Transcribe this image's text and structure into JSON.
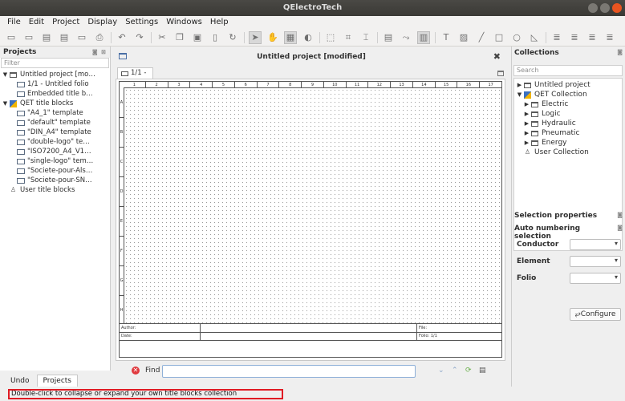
{
  "window": {
    "title": "QElectroTech"
  },
  "menu": [
    "File",
    "Edit",
    "Project",
    "Display",
    "Settings",
    "Windows",
    "Help"
  ],
  "toolbar": {
    "icons": [
      "new-project-icon",
      "open-icon",
      "save-icon",
      "save-as-icon",
      "close-project-icon",
      "print-icon",
      "undo-icon",
      "redo-icon",
      "cut-icon",
      "copy-icon",
      "paste-icon",
      "delete-icon",
      "rotate-icon",
      "select-icon",
      "hand-icon",
      "grid-icon",
      "mode-icon",
      "zoom-fit-icon",
      "zoom-content-icon",
      "zoom-reset-icon",
      "add-folio-icon",
      "conductor-icon",
      "titleblock-icon",
      "text-icon",
      "image-icon",
      "line-icon",
      "rectangle-icon",
      "ellipse-icon",
      "polygon-icon",
      "align-icon",
      "align-2-icon",
      "align-3-icon",
      "align-4-icon"
    ]
  },
  "projects": {
    "title": "Projects",
    "filter_placeholder": "Filter",
    "tree": [
      {
        "label": "Untitled project [mo…",
        "level": 0,
        "icon": "folder",
        "arrow": "▼"
      },
      {
        "label": "1/1 - Untitled folio",
        "level": 1,
        "icon": "page"
      },
      {
        "label": "Embedded title b…",
        "level": 1,
        "icon": "page"
      },
      {
        "label": "QET title blocks",
        "level": 0,
        "icon": "qet",
        "arrow": "▼"
      },
      {
        "label": "\"A4_1\" template",
        "level": 1,
        "icon": "page"
      },
      {
        "label": "\"default\" template",
        "level": 1,
        "icon": "page"
      },
      {
        "label": "\"DIN_A4\" template",
        "level": 1,
        "icon": "page"
      },
      {
        "label": "\"double-logo\" te…",
        "level": 1,
        "icon": "page"
      },
      {
        "label": "\"ISO7200_A4_V1…",
        "level": 1,
        "icon": "page"
      },
      {
        "label": "\"single-logo\" tem…",
        "level": 1,
        "icon": "page"
      },
      {
        "label": "\"Societe-pour-Als…",
        "level": 1,
        "icon": "page"
      },
      {
        "label": "\"Societe-pour-SN…",
        "level": 1,
        "icon": "page"
      },
      {
        "label": "User title blocks",
        "level": 0,
        "icon": "user"
      }
    ]
  },
  "left_tabs": {
    "undo": "Undo",
    "projects": "Projects"
  },
  "status": "Double-click to collapse or expand your own title blocks collection",
  "center": {
    "project_title": "Untitled project [modified]",
    "folio_tab": "1/1 -",
    "columns": [
      "1",
      "2",
      "3",
      "4",
      "5",
      "6",
      "7",
      "8",
      "9",
      "10",
      "11",
      "12",
      "13",
      "14",
      "15",
      "16",
      "17"
    ],
    "rows": [
      "A",
      "B",
      "C",
      "D",
      "E",
      "F",
      "G",
      "H"
    ],
    "titleblock": {
      "author": "Author:",
      "date": "Date:",
      "file": "File:",
      "folio": "Folio: 1/1"
    },
    "find_label": "Find :"
  },
  "collections": {
    "title": "Collections",
    "search_placeholder": "Search",
    "tree": [
      {
        "label": "Untitled project",
        "level": 0,
        "icon": "folder",
        "arrow": "▶"
      },
      {
        "label": "QET Collection",
        "level": 0,
        "icon": "qet",
        "arrow": "▼"
      },
      {
        "label": "Electric",
        "level": 1,
        "icon": "folder",
        "arrow": "▶"
      },
      {
        "label": "Logic",
        "level": 1,
        "icon": "folder",
        "arrow": "▶"
      },
      {
        "label": "Hydraulic",
        "level": 1,
        "icon": "folder",
        "arrow": "▶"
      },
      {
        "label": "Pneumatic",
        "level": 1,
        "icon": "folder",
        "arrow": "▶"
      },
      {
        "label": "Energy",
        "level": 1,
        "icon": "folder",
        "arrow": "▶"
      },
      {
        "label": "User Collection",
        "level": 0,
        "icon": "user"
      }
    ]
  },
  "selection_properties": "Selection properties",
  "auto_numbering": {
    "title": "Auto numbering selection",
    "conductor": "Conductor",
    "element": "Element",
    "folio": "Folio",
    "configure": "⥂Configure"
  }
}
